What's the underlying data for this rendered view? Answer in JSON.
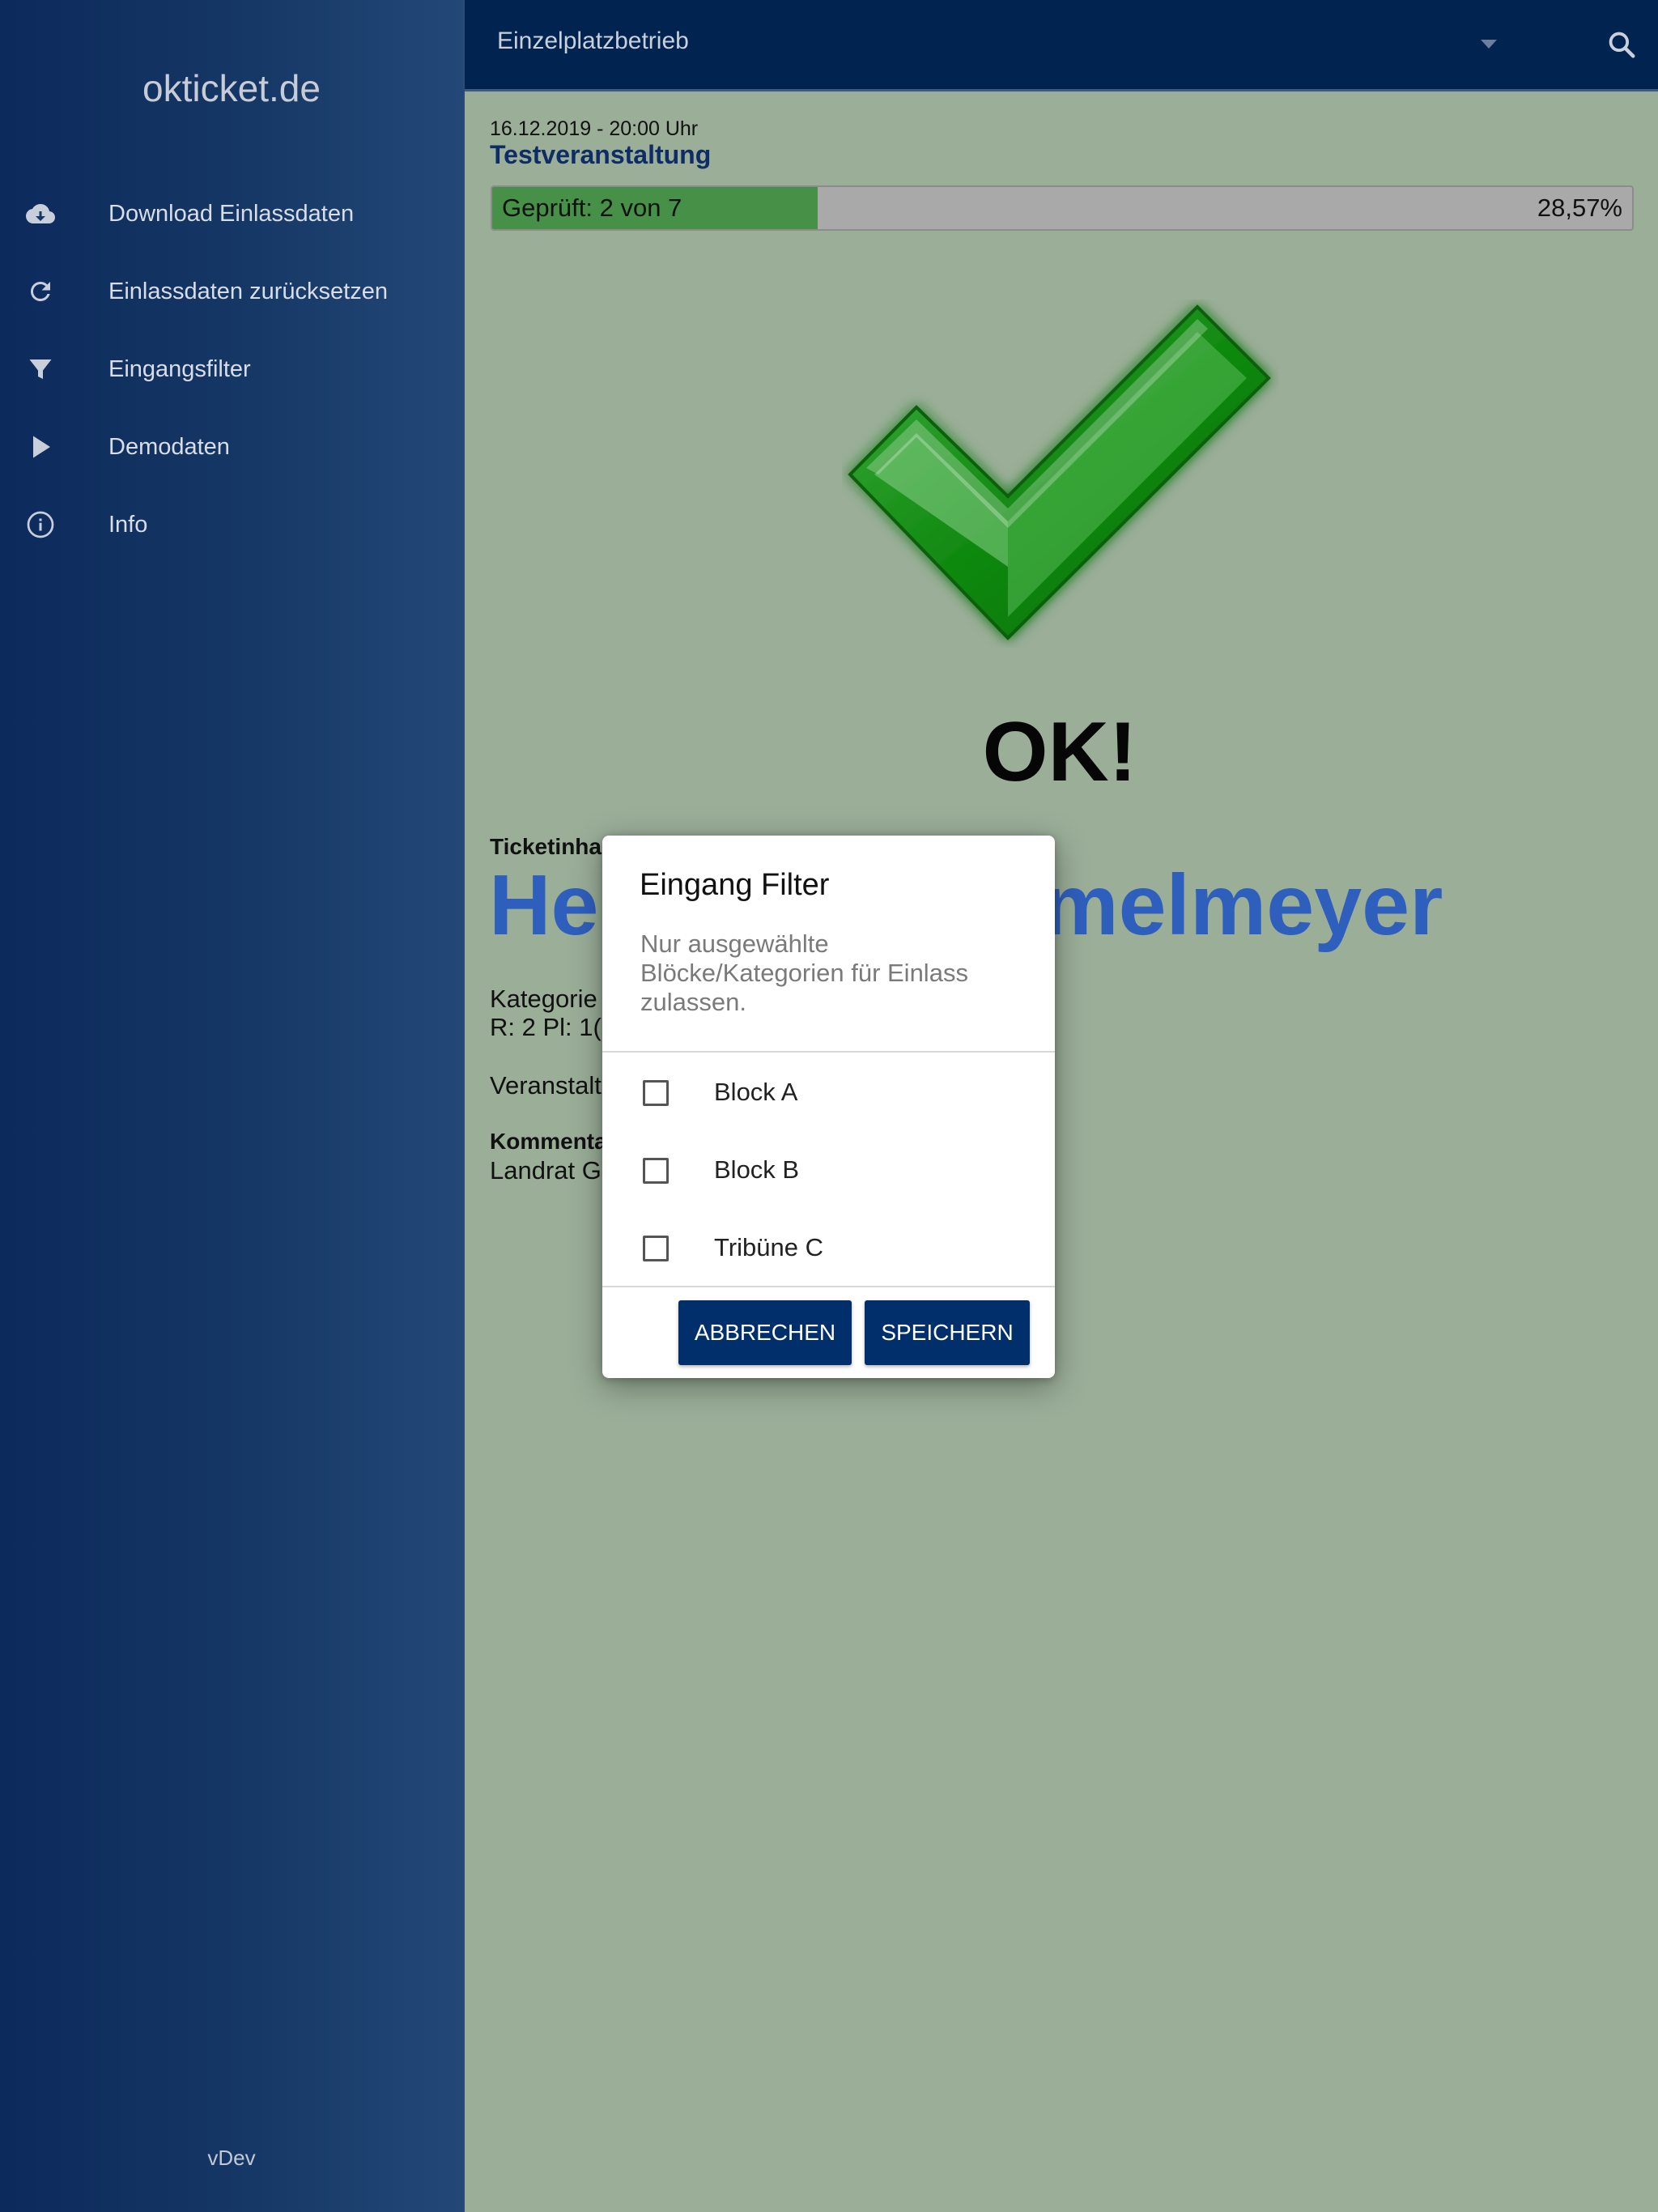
{
  "sidebar": {
    "brand": "okticket.de",
    "items": [
      {
        "label": "Download Einlassdaten",
        "icon": "cloud-download-icon"
      },
      {
        "label": "Einlassdaten zurücksetzen",
        "icon": "refresh-icon"
      },
      {
        "label": "Eingangsfilter",
        "icon": "filter-icon"
      },
      {
        "label": "Demodaten",
        "icon": "play-icon"
      },
      {
        "label": "Info",
        "icon": "info-icon"
      }
    ],
    "version": "vDev"
  },
  "topbar": {
    "mode": "Einzelplatzbetrieb",
    "search_icon": "search-icon"
  },
  "event": {
    "datetime": "16.12.2019 - 20:00 Uhr",
    "name": "Testveranstaltung"
  },
  "progress": {
    "label": "Geprüft:  2 von 7",
    "checked": 2,
    "total": 7,
    "percent_text": "28,57%",
    "fraction": 0.2857
  },
  "result": {
    "status": "OK!",
    "icon": "checkmark-icon"
  },
  "ticket": {
    "holder_label": "Ticketinha",
    "holder_name": "Her            emmelmeyer",
    "category_line": "Kategorie",
    "seat_line": "R: 2 Pl: 1(",
    "event_line": "Veranstalt",
    "comment_label": "Kommenta",
    "comment_line": "Landrat G"
  },
  "dialog": {
    "title": "Eingang Filter",
    "description": "Nur ausgewählte Blöcke/Kategorien für Einlass zulassen.",
    "options": [
      {
        "label": "Block A",
        "checked": false
      },
      {
        "label": "Block B",
        "checked": false
      },
      {
        "label": "Tribüne C",
        "checked": false
      }
    ],
    "cancel_label": "ABBRECHEN",
    "save_label": "SPEICHERN"
  },
  "colors": {
    "sidebar": "#0c2a5c",
    "topbar": "#002350",
    "content_bg": "#9aae98",
    "progress_fill": "#479047",
    "holder_name": "#2f5fbd",
    "button": "#002f6c"
  }
}
